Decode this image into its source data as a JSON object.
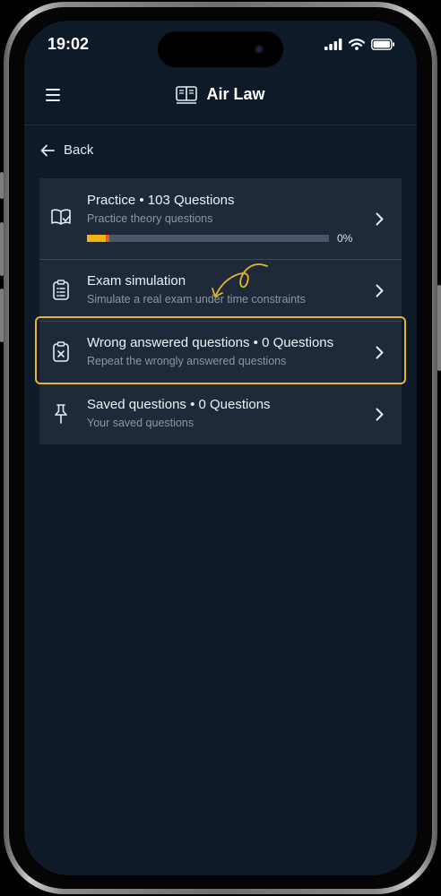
{
  "status_bar": {
    "time": "19:02"
  },
  "header": {
    "title": "Air Law",
    "menu_icon": "hamburger-icon",
    "title_icon": "book-icon"
  },
  "nav": {
    "back_label": "Back"
  },
  "items": [
    {
      "title": "Practice • 103 Questions",
      "subtitle": "Practice theory questions",
      "icon": "book-check-icon",
      "progress_percent": 0,
      "progress_label": "0%"
    },
    {
      "title": "Exam simulation",
      "subtitle": "Simulate a real exam under time constraints",
      "icon": "clipboard-list-icon"
    },
    {
      "title": "Wrong answered questions • 0 Questions",
      "subtitle": "Repeat the wrongly answered questions",
      "icon": "clipboard-x-icon"
    },
    {
      "title": "Saved questions • 0 Questions",
      "subtitle": "Your saved questions",
      "icon": "pin-icon"
    }
  ],
  "colors": {
    "background": "#0f1a29",
    "card": "#1e2a3a",
    "accent": "#f2b516",
    "highlight": "#e9b429"
  }
}
